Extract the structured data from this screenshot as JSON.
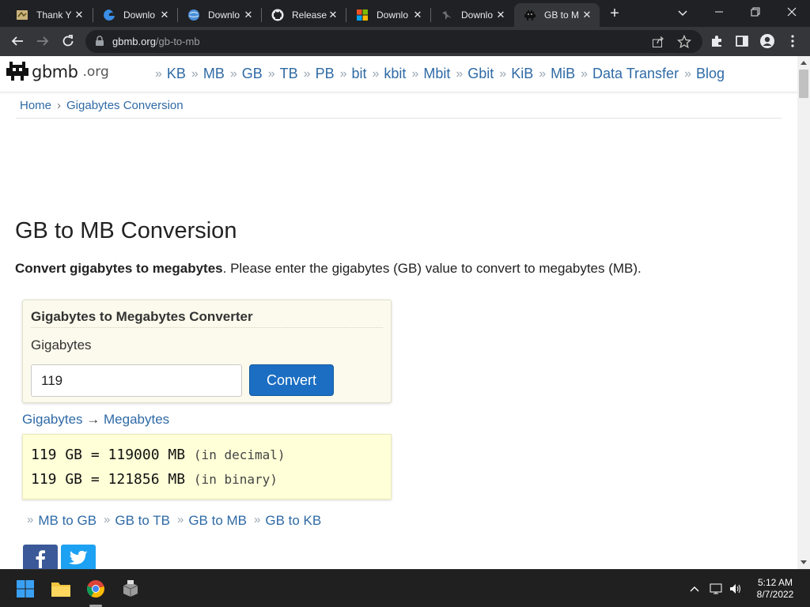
{
  "browser": {
    "tabs": [
      {
        "title": "Thank Y",
        "icon": "page-icon",
        "active": false
      },
      {
        "title": "Downlo",
        "icon": "edge-icon",
        "active": false
      },
      {
        "title": "Downlo",
        "icon": "globe-icon",
        "active": false
      },
      {
        "title": "Release",
        "icon": "github-icon",
        "active": false
      },
      {
        "title": "Downlo",
        "icon": "windows-logo-icon",
        "active": false
      },
      {
        "title": "Downlo",
        "icon": "bird-icon",
        "active": false
      },
      {
        "title": "GB to M",
        "icon": "gbmb-icon",
        "active": true
      }
    ],
    "url_host": "gbmb.org",
    "url_path": "/gb-to-mb"
  },
  "site": {
    "logo_name": "gbmb",
    "logo_tld": ".org",
    "nav": [
      "KB",
      "MB",
      "GB",
      "TB",
      "PB",
      "bit",
      "kbit",
      "Mbit",
      "Gbit",
      "KiB",
      "MiB",
      "Data Transfer",
      "Blog"
    ],
    "nav_separator": "»",
    "breadcrumb": {
      "home": "Home",
      "chevron": "›",
      "current": "Gigabytes Conversion"
    }
  },
  "main": {
    "title": "GB to MB Conversion",
    "lead_bold": "Convert gigabytes to megabytes",
    "lead_rest": ". Please enter the gigabytes (GB) value to convert to megabytes (MB).",
    "converter": {
      "heading": "Gigabytes to Megabytes Converter",
      "label": "Gigabytes",
      "input_value": "119",
      "button_label": "Convert"
    },
    "direction": {
      "from": "Gigabytes",
      "arrow": "→",
      "to": "Megabytes"
    },
    "results": [
      {
        "text": "119 GB = 119000 MB",
        "note": "(in decimal)"
      },
      {
        "text": "119 GB = 121856 MB",
        "note": "(in binary)"
      }
    ],
    "related": [
      "MB to GB",
      "GB to TB",
      "GB to MB",
      "GB to KB"
    ],
    "social": [
      "facebook-icon",
      "twitter-icon"
    ]
  },
  "taskbar": {
    "time": "5:12 AM",
    "date": "8/7/2022"
  },
  "colors": {
    "link": "#2f6aa6",
    "button": "#1b6ec2",
    "converter_bg": "#fbfaec",
    "result_bg": "#ffffd8",
    "facebook": "#3b5998",
    "twitter": "#1da1f2"
  }
}
